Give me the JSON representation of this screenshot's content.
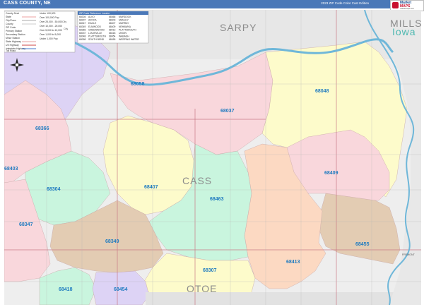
{
  "header": {
    "title": "CASS COUNTY, NE",
    "edition": "2023 ZIP Code Color Cast Edition"
  },
  "logo": {
    "line1": "Market",
    "line2": "MAPS",
    "line3": "marketmaps.com"
  },
  "map_labels": {
    "counties": [
      "SARPY",
      "CASS",
      "OTOE"
    ],
    "neighbor_county": "MILLS",
    "neighbor_state": "Iowa",
    "fremont_label": "FREMONT",
    "zip_codes": [
      "68048",
      "68037",
      "68058",
      "68366",
      "68409",
      "68304",
      "68407",
      "68463",
      "68347",
      "68349",
      "68455",
      "68413",
      "68307",
      "68418",
      "68454",
      "68403"
    ]
  },
  "legend": {
    "items": [
      {
        "label": "County Seat"
      },
      {
        "label": "State"
      },
      {
        "label": "City/Town"
      },
      {
        "label": "County"
      },
      {
        "label": "ZIP Code"
      },
      {
        "label": "Primary Station"
      },
      {
        "label": "Secondary Station"
      },
      {
        "label": "Minor Station"
      },
      {
        "label": "State Highway"
      },
      {
        "label": "US Highway"
      },
      {
        "label": "Interstate Highway"
      },
      {
        "label": "Toll Road"
      }
    ],
    "population_items": [
      {
        "label": "Under 100,000"
      },
      {
        "label": "Over 100,000 Pop"
      },
      {
        "label": "Over 25,000 - 50,000"
      },
      {
        "label": "Over 10,000 - 25,000"
      },
      {
        "label": "Over 5,000 to 10,000"
      },
      {
        "label": "Over 1,000 to 5,000"
      },
      {
        "label": "Under 1,000 Pop"
      }
    ],
    "sample_city": "City",
    "sample_city2": "City"
  },
  "zip_table": {
    "header": "ZIP Code Reference Locator",
    "rows": [
      [
        "68304",
        "ALVO",
        "68366",
        "MURDOCK"
      ],
      [
        "68307",
        "AVOCA",
        "68403",
        "MANLEY"
      ],
      [
        "68347",
        "EAGLE",
        "68407",
        "MURRAY"
      ],
      [
        "68349",
        "ELMWOOD",
        "68409",
        "NEHAWKA"
      ],
      [
        "68366",
        "GREENWOOD",
        "68413",
        "PLATTSMOUTH"
      ],
      [
        "68037",
        "LOUISVILLE",
        "68418",
        "UNION"
      ],
      [
        "68048",
        "PLATTSMOUTH",
        "68454",
        "WABASH"
      ],
      [
        "68058",
        "SOUTH BEND",
        "68455",
        "WEEPING WATER"
      ]
    ]
  },
  "colors": {
    "header_bg": "#4a78b8",
    "zip_label": "#1f7bc0",
    "county_label": "#8c8c8c",
    "river": "#6fb7d9",
    "pink": "#f9d7dc",
    "yellow": "#fdfbcb",
    "teal": "#c9f5de",
    "tan": "#e3ccb3",
    "peach": "#fcd9c2",
    "lavender": "#ddd3f5",
    "gray": "#dfdfdf"
  }
}
